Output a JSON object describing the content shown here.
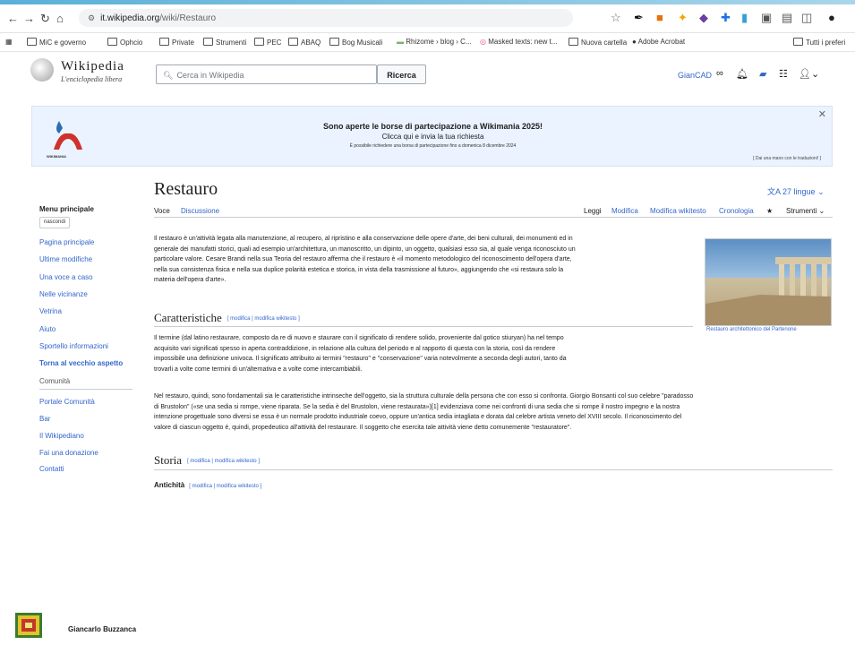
{
  "browser": {
    "url_host": "it.wikipedia.org",
    "url_path": "/wiki/Restauro",
    "bookmarks": [
      "MiC e governo",
      "Ophcio",
      "Private",
      "Strumenti",
      "PEC",
      "ABAQ",
      "Bog Musicali",
      "Rhizome › blog › C...",
      "Masked texts: new t...",
      "Nuova cartella",
      "Adobe Acrobat",
      "Tutti i preferi"
    ]
  },
  "wiki": {
    "title": "Wikipedia",
    "subtitle": "L'enciclopedia libera",
    "search_placeholder": "Cerca in Wikipedia",
    "search_button": "Ricerca",
    "user": "GianCAD"
  },
  "banner": {
    "heading": "Sono aperte le borse di partecipazione a Wikimania 2025!",
    "link": "Clicca qui e invia la tua richiesta",
    "small": "È possibile richiedere una borsa di partecipazione fino a domenica 8 dicembre 2024",
    "translate": "[ Dai una mano con le traduzioni! ]",
    "logo_caption": "WIKIMANIA"
  },
  "page": {
    "title": "Restauro",
    "languages": "27 lingue",
    "tabs": {
      "voce": "Voce",
      "discussione": "Discussione",
      "leggi": "Leggi",
      "modifica": "Modifica",
      "modifica_wikitesto": "Modifica wikitesto",
      "cronologia": "Cronologia",
      "strumenti": "Strumenti"
    }
  },
  "sidebar": {
    "heading": "Menu principale",
    "hide": "nascondi",
    "items": [
      "Pagina principale",
      "Ultime modifiche",
      "Una voce a caso",
      "Nelle vicinanze",
      "Vetrina",
      "Aiuto",
      "Sportello informazioni",
      "Torna al vecchio aspetto"
    ],
    "community_heading": "Comunità",
    "community_items": [
      "Portale Comunità",
      "Bar",
      "Il Wikipediano",
      "Fai una donazione",
      "Contatti"
    ]
  },
  "article": {
    "intro": [
      "Il restauro è un'attività legata alla manutenzione, al recupero, al ripristino e alla conservazione delle opere d'arte, dei beni culturali, dei monumenti ed in",
      "generale dei manufatti storici, quali ad esempio un'architettura, un manoscritto, un dipinto, un oggetto, qualsiasi esso sia, al quale venga riconosciuto un",
      "particolare valore. Cesare Brandi nella sua Teoria del restauro afferma che il restauro è «il momento metodologico del riconoscimento dell'opera d'arte,",
      "nella sua consistenza fisica e nella sua duplice polarità estetica e storica, in vista della trasmissione al futuro», aggiungendo che «si restaura solo la",
      "materia dell'opera d'arte»."
    ],
    "h2_1": "Caratteristiche",
    "edit_links": "[ modifica | modifica wikitesto ]",
    "p1": [
      "Il termine (dal latino restaurare, composto da re di nuovo e staurare con il significato di rendere solido, proveniente dal gotico stiuryan) ha nel tempo",
      "acquisito vari significati spesso in aperta contraddizione, in relazione alla cultura del periodo e al rapporto di questa con la storia, così da rendere",
      "impossibile una definizione univoca. Il significato attribuito ai termini \"restauro\" e \"conservazione\" varia notevolmente a seconda degli autori, tanto da",
      "trovarli a volte come termini di un'alternativa e a volte come intercambiabili."
    ],
    "p2": [
      "Nel restauro, quindi, sono fondamentali sia le caratteristiche intrinseche dell'oggetto, sia la struttura culturale della persona che con esso si confronta. Giorgio Bonsanti col suo celebre \"paradosso",
      "di Brustolon\" («se una sedia si rompe, viene riparata. Se la sedia è del Brustolon, viene restaurata»)[1] evidenziava come nei confronti di una sedia che si rompe il nostro impegno e la nostra",
      "intenzione progettuale sono diversi se essa è un normale prodotto industriale coevo, oppure un'antica sedia intagliata e dorata dal celebre artista veneto del XVIII secolo. Il riconoscimento del",
      "valore di ciascun oggetto è, quindi, propedeutico all'attività del restaurare. Il soggetto che esercita tale attività viene detto comunemente \"restauratore\"."
    ],
    "h2_2": "Storia",
    "h3": "Antichità",
    "image_caption": "Restauro architettonico del Partenone"
  },
  "footer": {
    "author": "Giancarlo Buzzanca"
  }
}
